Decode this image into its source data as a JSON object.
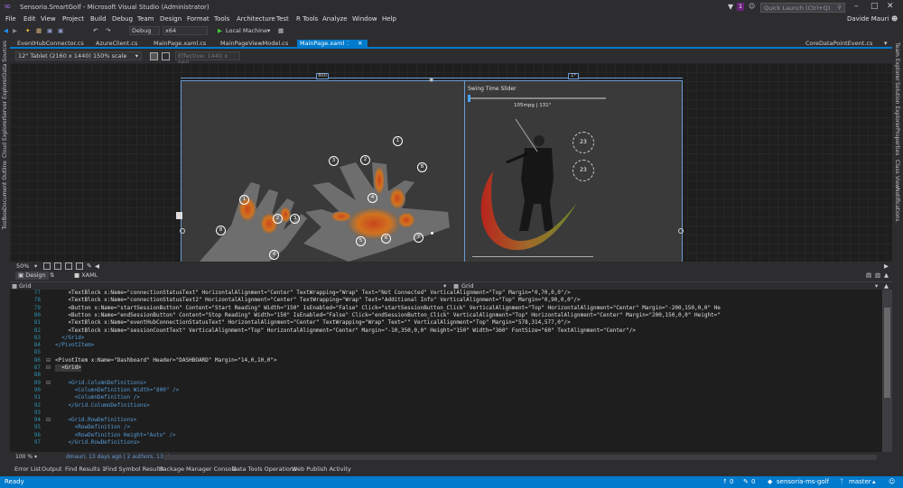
{
  "window": {
    "title": "Sensoria.SmartGolf - Microsoft Visual Studio (Administrator)",
    "user": "Davide Mauri",
    "notification_count": "1",
    "quick_launch_placeholder": "Quick Launch (Ctrl+Q)"
  },
  "menu": [
    "File",
    "Edit",
    "View",
    "Project",
    "Build",
    "Debug",
    "Team",
    "Design",
    "Format",
    "Tools",
    "Architecture",
    "Test",
    "R Tools",
    "Analyze",
    "Window",
    "Help"
  ],
  "toolbar": {
    "config": "Debug",
    "platform": "x64",
    "run_label": "Local Machine"
  },
  "tabs": [
    {
      "label": "EventHubConnector.cs",
      "active": false
    },
    {
      "label": "AzureClient.cs",
      "active": false
    },
    {
      "label": "MainPage.xaml.cs",
      "active": false
    },
    {
      "label": "MainPageViewModel.cs",
      "active": false
    },
    {
      "label": "MainPage.xaml",
      "active": true
    },
    {
      "label": "CoreDataPointEvent.cs",
      "active": false
    }
  ],
  "left_rail": [
    "Data Sources",
    "Server Explorer",
    "Cloud Explorer",
    "Document Outline",
    "Toolbox"
  ],
  "right_rail": [
    "Team Explorer",
    "Solution Explorer",
    "Properties",
    "Class View",
    "Notifications"
  ],
  "design": {
    "device": "12\" Tablet (2160 x 1440) 150% scale",
    "effective": "Effective: 1440 x 960",
    "col_width_label": "800",
    "col_star_label": "1*",
    "slider_title": "Swing Time Slider",
    "swing_stats": "105mpg | 131°",
    "stat_a": "23",
    "stat_b": "23",
    "left_hand_labels": [
      "1",
      "2",
      "3",
      "4",
      "8"
    ],
    "right_hand_labels": [
      "1",
      "2",
      "3",
      "4",
      "5",
      "6",
      "7",
      "8"
    ]
  },
  "zoom": {
    "level": "50%"
  },
  "split": {
    "design_tab": "Design",
    "xaml_tab": "XAML"
  },
  "crumbs": {
    "left": "Grid",
    "right": "Grid"
  },
  "code": [
    {
      "n": "77",
      "t": "    <TextBlock x:Name=\"connectionStatusText\" HorizontalAlignment=\"Center\" TextWrapping=\"Wrap\" Text=\"Not Connected\" VerticalAlignment=\"Top\" Margin=\"0,70,0,0\"/>"
    },
    {
      "n": "78",
      "t": "    <TextBlock x:Name=\"connectionStatusText2\" HorizontalAlignment=\"Center\" TextWrapping=\"Wrap\" Text=\"Additional Info\" VerticalAlignment=\"Top\" Margin=\"0,90,0,0\"/>"
    },
    {
      "n": "79",
      "t": "    <Button x:Name=\"startSessionButton\" Content=\"Start Reading\" Width=\"150\" IsEnabled=\"False\" Click=\"startSessionButton_Click\" VerticalAlignment=\"Top\" HorizontalAlignment=\"Center\" Margin=\"-200,150,0,0\" He"
    },
    {
      "n": "80",
      "t": "    <Button x:Name=\"endSessionButton\" Content=\"Stop Reading\" Width=\"150\" IsEnabled=\"False\" Click=\"endSessionButton_Click\" VerticalAlignment=\"Top\" HorizontalAlignment=\"Center\" Margin=\"200,150,0,0\" Height=\""
    },
    {
      "n": "81",
      "t": "    <TextBlock x:Name=\"eventHubConnectionStatusText\" HorizontalAlignment=\"Center\" TextWrapping=\"Wrap\" Text=\"\" VerticalAlignment=\"Top\" Margin=\"578,314,577,0\"/>"
    },
    {
      "n": "82",
      "t": "    <TextBlock x:Name=\"sessionCountText\" VerticalAlignment=\"Top\" HorizontalAlignment=\"Center\" Margin=\"-10,350,0,0\" Height=\"150\" Width=\"360\" FontSize=\"60\" TextAlignment=\"Center\"/>"
    },
    {
      "n": "83",
      "t": "  </Grid>"
    },
    {
      "n": "84",
      "t": "</PivotItem>"
    },
    {
      "n": "85",
      "t": ""
    },
    {
      "n": "86",
      "t": "<PivotItem x:Name=\"Dashboard\" Header=\"DASHBOARD\" Margin=\"14,0,10,0\">"
    },
    {
      "n": "87",
      "t": "  <Grid>"
    },
    {
      "n": "88",
      "t": ""
    },
    {
      "n": "89",
      "t": "    <Grid.ColumnDefinitions>"
    },
    {
      "n": "90",
      "t": "      <ColumnDefinition Width=\"800\" />"
    },
    {
      "n": "91",
      "t": "      <ColumnDefinition />"
    },
    {
      "n": "92",
      "t": "    </Grid.ColumnDefinitions>"
    },
    {
      "n": "93",
      "t": ""
    },
    {
      "n": "94",
      "t": "    <Grid.RowDefinitions>"
    },
    {
      "n": "95",
      "t": "      <RowDefinition />"
    },
    {
      "n": "96",
      "t": "      <RowDefinition Height=\"Auto\" />"
    },
    {
      "n": "97",
      "t": "    </Grid.RowDefinitions>"
    }
  ],
  "editor_footer": {
    "zoom": "100 %",
    "blame": "dmauri, 13 days ago | 2 authors, 13 changes"
  },
  "bottom_tabs": [
    "Error List",
    "Output",
    "Find Results 1",
    "Find Symbol Results",
    "Package Manager Console",
    "Data Tools Operations",
    "Web Publish Activity"
  ],
  "status": {
    "left": "Ready",
    "up_count": "0",
    "pencil_count": "0",
    "branch_repo": "sensoria-ms-golf",
    "branch": "master"
  }
}
